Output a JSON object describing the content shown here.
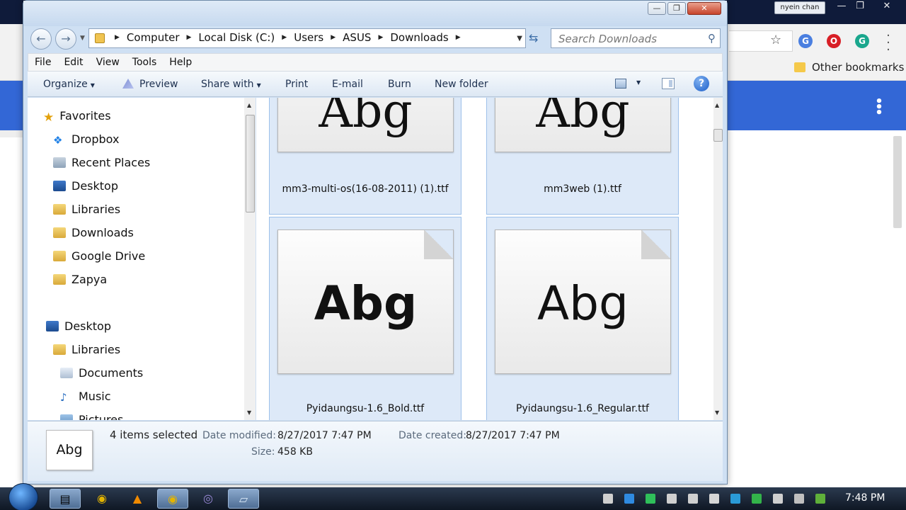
{
  "background_browser": {
    "user_badge": "nyein chan",
    "bookmark_folder": "Other bookmarks",
    "win_controls": [
      "—",
      "❐",
      "✕"
    ]
  },
  "explorer": {
    "window_controls": {
      "minimize": "—",
      "maximize": "❐",
      "close": "✕"
    },
    "nav": {
      "back": "←",
      "forward": "→"
    },
    "breadcrumb": [
      "Computer",
      "Local Disk (C:)",
      "Users",
      "ASUS",
      "Downloads"
    ],
    "search": {
      "placeholder": "Search Downloads"
    },
    "menu": [
      "File",
      "Edit",
      "View",
      "Tools",
      "Help"
    ],
    "commands": {
      "organize": "Organize",
      "preview": "Preview",
      "share_with": "Share with",
      "print": "Print",
      "email": "E-mail",
      "burn": "Burn",
      "new_folder": "New folder",
      "help": "?"
    },
    "nav_pane": {
      "favorites_label": "Favorites",
      "favorites": [
        "Dropbox",
        "Recent Places",
        "Desktop",
        "Libraries",
        "Downloads",
        "Google Drive",
        "Zapya"
      ],
      "tree": [
        "Desktop",
        "Libraries",
        "Documents",
        "Music",
        "Pictures"
      ]
    },
    "files": [
      {
        "name": "mm3-multi-os(16-08-2011) (1).ttf",
        "preview": "Abg",
        "selected": true
      },
      {
        "name": "mm3web (1).ttf",
        "preview": "Abg",
        "selected": true
      },
      {
        "name": "Pyidaungsu-1.6_Bold.ttf",
        "preview": "Abg",
        "selected": true
      },
      {
        "name": "Pyidaungsu-1.6_Regular.ttf",
        "preview": "Abg",
        "selected": true
      }
    ],
    "details": {
      "preview": "Abg",
      "selection": "4 items selected",
      "date_modified_label": "Date modified:",
      "date_modified": "8/27/2017 7:47 PM",
      "date_created_label": "Date created:",
      "date_created": "8/27/2017 7:47 PM",
      "size_label": "Size:",
      "size": "458 KB"
    }
  },
  "taskbar": {
    "clock": "7:48 PM"
  },
  "colors": {
    "selection_fill": "#dde9f8",
    "selection_border": "#9ec1ea",
    "chrome_blue": "#3367d6",
    "explorer_frame": "#cfe0f3"
  }
}
